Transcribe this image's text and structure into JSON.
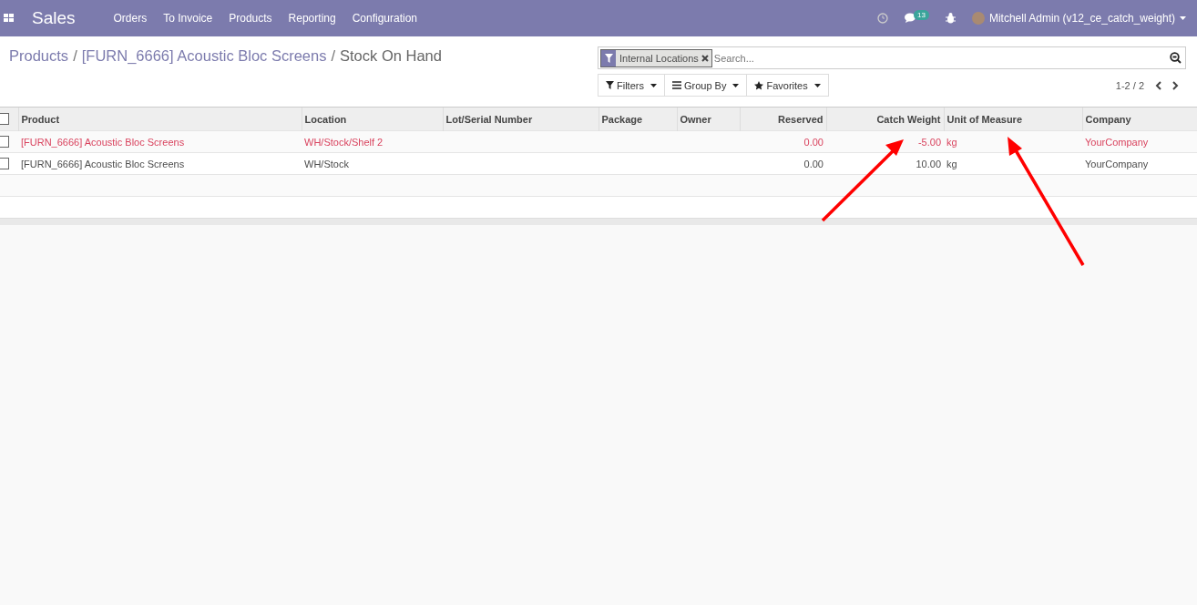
{
  "navbar": {
    "app_title": "Sales",
    "menu": [
      "Orders",
      "To Invoice",
      "Products",
      "Reporting",
      "Configuration"
    ],
    "messages_count": "13",
    "user": "Mitchell Admin (v12_ce_catch_weight)"
  },
  "breadcrumb": {
    "separator": "/",
    "items": [
      "Products",
      "[FURN_6666] Acoustic Bloc Screens",
      "Stock On Hand"
    ]
  },
  "search": {
    "facet": "Internal Locations",
    "placeholder": "Search..."
  },
  "buttons": [
    "Filters",
    "Group By",
    "Favorites"
  ],
  "pager": "1-2 / 2",
  "table": {
    "all_checked": false,
    "columns": [
      {
        "label": "Product",
        "kind": "text"
      },
      {
        "label": "Location",
        "kind": "text"
      },
      {
        "label": "Lot/Serial Number",
        "kind": "text"
      },
      {
        "label": "Package",
        "kind": "text"
      },
      {
        "label": "Owner",
        "kind": "text"
      },
      {
        "label": "Reserved",
        "kind": "number"
      },
      {
        "label": "Catch Weight",
        "kind": "number"
      },
      {
        "label": "Unit of Measure",
        "kind": "text"
      },
      {
        "label": "Company",
        "kind": "text"
      }
    ],
    "rows": [
      {
        "negative": true,
        "checked": false,
        "cells": [
          "[FURN_6666] Acoustic Bloc Screens",
          "WH/Stock/Shelf 2",
          "",
          "",
          "",
          "0.00",
          "-5.00",
          "kg",
          "YourCompany"
        ]
      },
      {
        "negative": false,
        "checked": false,
        "cells": [
          "[FURN_6666] Acoustic Bloc Screens",
          "WH/Stock",
          "",
          "",
          "",
          "0.00",
          "10.00",
          "kg",
          "YourCompany"
        ]
      }
    ]
  }
}
